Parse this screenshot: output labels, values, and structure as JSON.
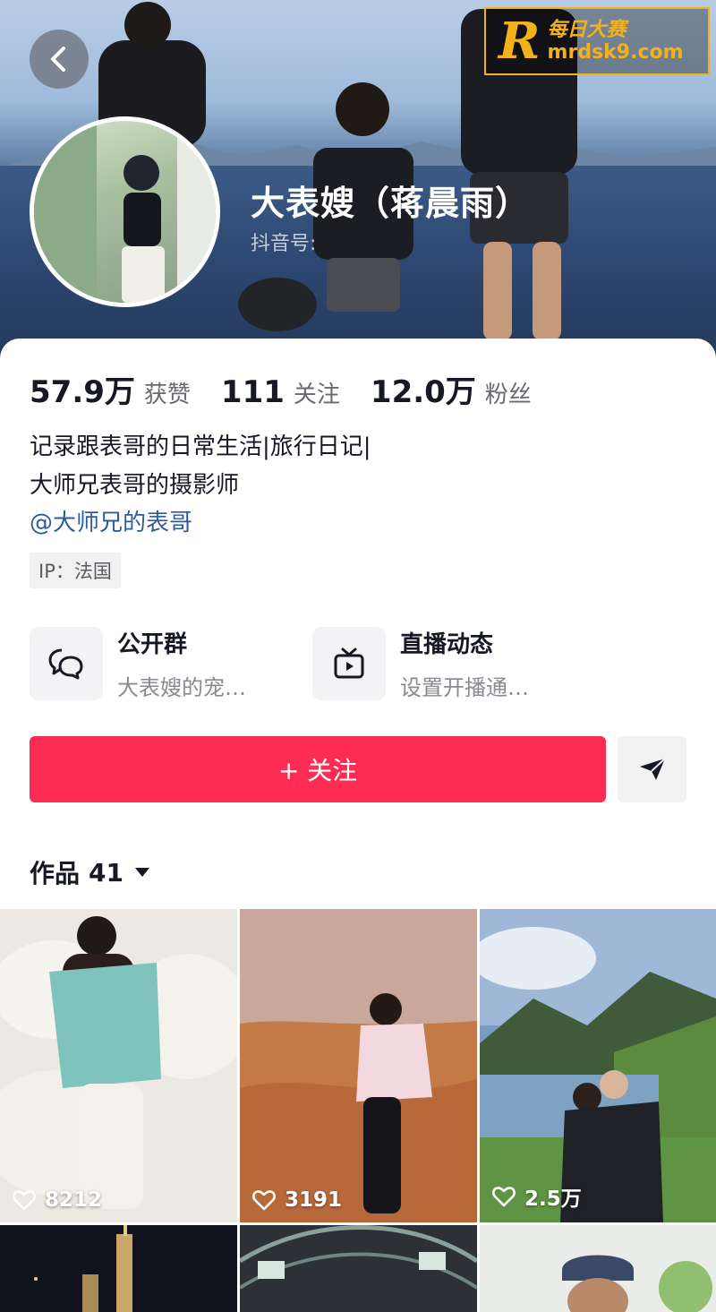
{
  "watermark": {
    "logo_letter": "R",
    "site_name": "每日大赛",
    "site_url": "mrdsk9.com",
    "accent": "#f2b21b"
  },
  "header": {
    "back_icon": "chevron-left-icon"
  },
  "profile": {
    "nickname": "大表嫂（蒋晨雨）",
    "douyin_id_label": "抖音号:"
  },
  "stats": [
    {
      "value": "57.9万",
      "label": "获赞"
    },
    {
      "value": "111",
      "label": "关注"
    },
    {
      "value": "12.0万",
      "label": "粉丝"
    }
  ],
  "bio": {
    "line1": "记录跟表哥的日常生活|旅行日记|",
    "line2": "大师兄表哥的摄影师",
    "mention": "@大师兄的表哥"
  },
  "ip_tag": "IP：法国",
  "entries": [
    {
      "icon": "chat-bubbles-icon",
      "title": "公开群",
      "subtitle": "大表嫂的宠…"
    },
    {
      "icon": "tv-live-icon",
      "title": "直播动态",
      "subtitle": "设置开播通…"
    }
  ],
  "actions": {
    "follow_label": "+ 关注",
    "share_icon": "send-icon",
    "brand_red": "#fe2c55"
  },
  "works": {
    "label": "作品",
    "count": "41"
  },
  "videos": [
    {
      "likes": "8212"
    },
    {
      "likes": "3191"
    },
    {
      "likes": "2.5万"
    },
    {
      "likes": ""
    },
    {
      "likes": ""
    },
    {
      "likes": ""
    }
  ]
}
